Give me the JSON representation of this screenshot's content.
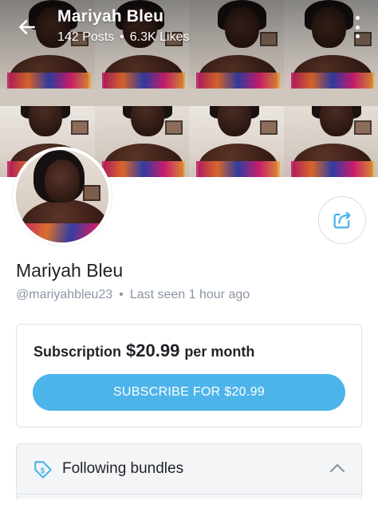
{
  "header": {
    "title": "Mariyah Bleu",
    "posts": "142 Posts",
    "likes": "6.3K Likes",
    "separator": "•"
  },
  "icons": {
    "back": "arrow-left-icon",
    "more": "more-vertical-icon",
    "share": "share-icon",
    "bundles": "tag-dollar-icon",
    "collapse": "chevron-up-icon"
  },
  "profile": {
    "name": "Mariyah Bleu",
    "handle": "@mariyahbleu23",
    "separator": "•",
    "last_seen": "Last seen 1 hour ago"
  },
  "subscription": {
    "label": "Subscription",
    "price": "$20.99",
    "period": "per month",
    "button_label": "SUBSCRIBE FOR $20.99"
  },
  "bundles": {
    "title": "Following bundles"
  },
  "colors": {
    "accent": "#4db4ea",
    "muted_text": "#8a96a3",
    "border": "#dfe3e8"
  }
}
